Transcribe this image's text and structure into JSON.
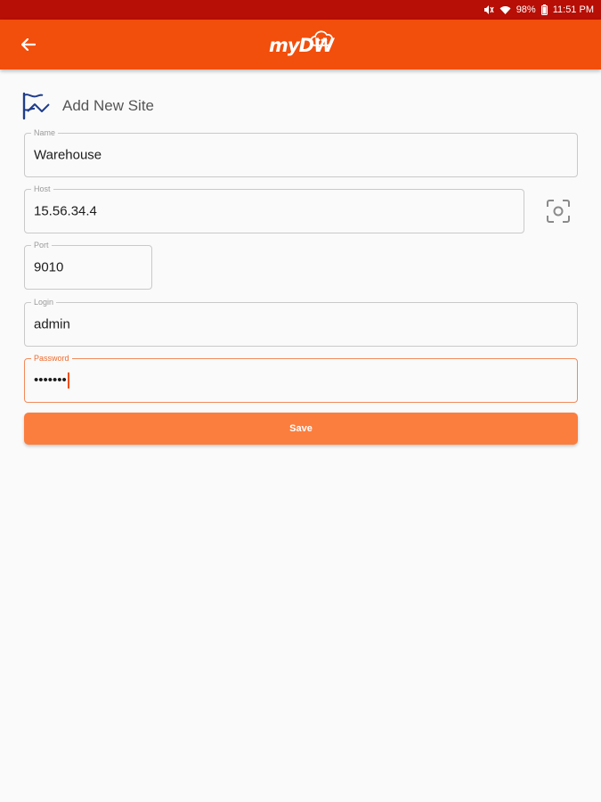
{
  "status_bar": {
    "icons": [
      "mute-icon",
      "wifi-icon",
      "battery-icon"
    ],
    "battery": "98%",
    "time": "11:51 PM"
  },
  "app_bar": {
    "back_icon": "arrow-left-icon",
    "logo_text": "myDW",
    "background": "#f24e0c"
  },
  "page": {
    "icon": "site-flag-icon",
    "title": "Add New Site"
  },
  "form": {
    "name": {
      "label": "Name",
      "value": "Warehouse"
    },
    "host": {
      "label": "Host",
      "value": "15.56.34.4"
    },
    "scan_icon": "qr-scan-icon",
    "port": {
      "label": "Port",
      "value": "9010"
    },
    "login": {
      "label": "Login",
      "value": "admin"
    },
    "password": {
      "label": "Password",
      "value": "•••••••",
      "focused": true
    },
    "save_label": "Save"
  },
  "colors": {
    "status_bar": "#b70e05",
    "accent": "#f24e0c",
    "save_button": "#fb7e3e",
    "background": "#fafafa"
  }
}
